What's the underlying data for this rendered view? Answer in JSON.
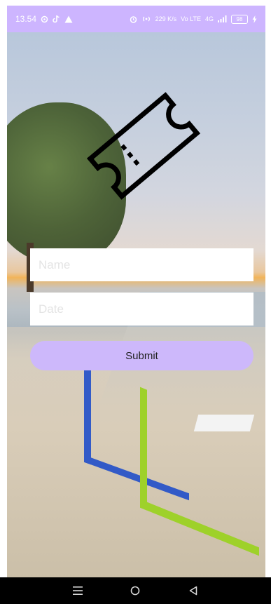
{
  "status_bar": {
    "time": "13.54",
    "left_icons": [
      "settings-dot-icon",
      "tiktok-icon",
      "alert-triangle-icon"
    ],
    "right_icons": [
      "alarm-icon",
      "hotspot-icon",
      "data-speed-icon",
      "volte-icon",
      "signal-icon",
      "battery-icon"
    ],
    "data_speed": "229 K/s",
    "volte": "Vo LTE",
    "network": "4G",
    "battery": "98",
    "bg_color": "#cdb5ff"
  },
  "main": {
    "hero_icon": "ticket-icon"
  },
  "form": {
    "name_placeholder": "Name",
    "name_value": "",
    "date_placeholder": "Date",
    "date_value": "",
    "submit_label": "Submit",
    "button_color": "#cdb8fb"
  },
  "nav_bar": {
    "buttons": [
      "menu-icon",
      "home-icon",
      "back-icon"
    ]
  }
}
